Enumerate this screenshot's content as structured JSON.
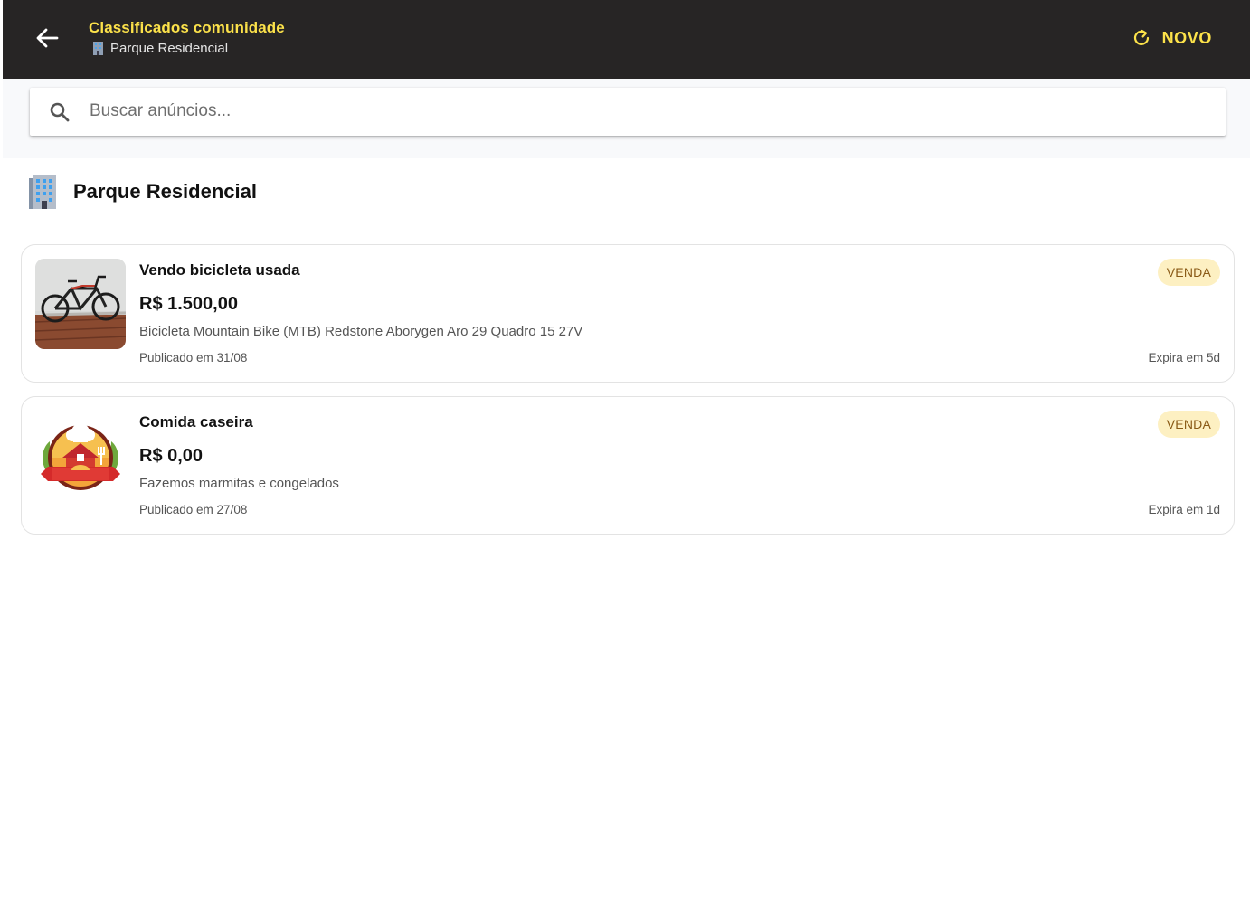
{
  "header": {
    "title": "Classificados comunidade",
    "subtitle": "Parque Residencial",
    "new_label": "NOVO",
    "background": "#272525",
    "accent": "#fce24a"
  },
  "search": {
    "placeholder": "Buscar anúncios...",
    "value": ""
  },
  "section": {
    "title": "Parque Residencial",
    "icon": "office-building-icon"
  },
  "listings": [
    {
      "title": "Vendo bicicleta usada",
      "price": "R$ 1.500,00",
      "description": "Bicicleta Mountain Bike (MTB) Redstone Aborygen Aro 29 Quadro 15 27V",
      "published": "Publicado em 31/08",
      "expires": "Expira em 5d",
      "badge": "VENDA",
      "image": "bicycle-photo"
    },
    {
      "title": "Comida caseira",
      "price": "R$ 0,00",
      "description": "Fazemos marmitas e congelados",
      "published": "Publicado em 27/08",
      "expires": "Expira em 1d",
      "badge": "VENDA",
      "image": "homemade-food-logo"
    }
  ]
}
